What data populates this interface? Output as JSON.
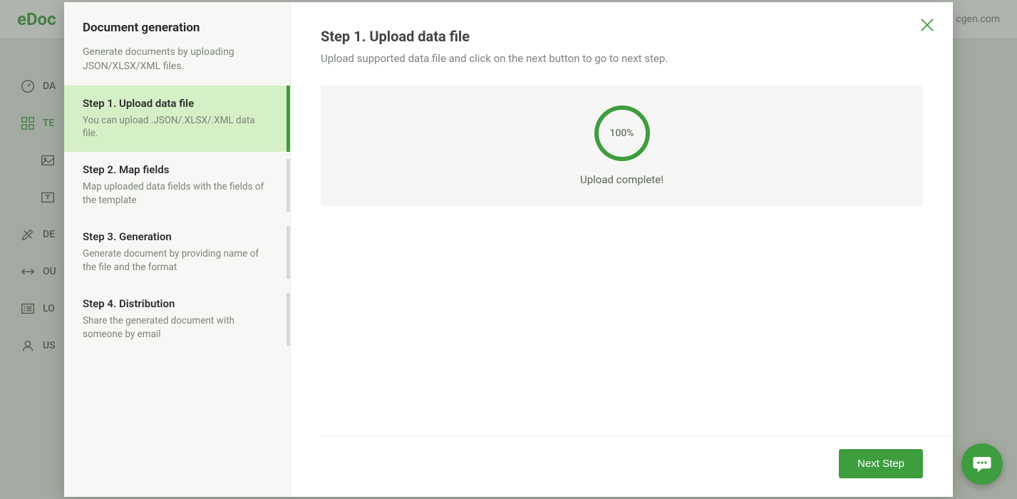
{
  "header": {
    "logo": "eDoc",
    "right_text": "cgen.com"
  },
  "sidebar": {
    "items": [
      {
        "label": "DA"
      },
      {
        "label": "TE"
      },
      {
        "label": ""
      },
      {
        "label": ""
      },
      {
        "label": "DE"
      },
      {
        "label": "OU"
      },
      {
        "label": "LO"
      },
      {
        "label": "US"
      }
    ]
  },
  "modal": {
    "left": {
      "title": "Document generation",
      "desc": "Generate documents by uploading JSON/XLSX/XML files.",
      "steps": [
        {
          "title": "Step 1. Upload data file",
          "desc": "You can upload .JSON/.XLSX/.XML data file."
        },
        {
          "title": "Step 2. Map fields",
          "desc": "Map uploaded data fields with the fields of the template"
        },
        {
          "title": "Step 3. Generation",
          "desc": "Generate document by providing name of the file and the format"
        },
        {
          "title": "Step 4. Distribution",
          "desc": "Share the generated document with someone by email"
        }
      ]
    },
    "main": {
      "title": "Step 1. Upload data file",
      "subtitle": "Upload supported data file and click on the next button to go to next step.",
      "progress_percent": "100%",
      "upload_status": "Upload complete!",
      "next_button": "Next Step"
    }
  },
  "colors": {
    "accent": "#3e9d3e"
  }
}
